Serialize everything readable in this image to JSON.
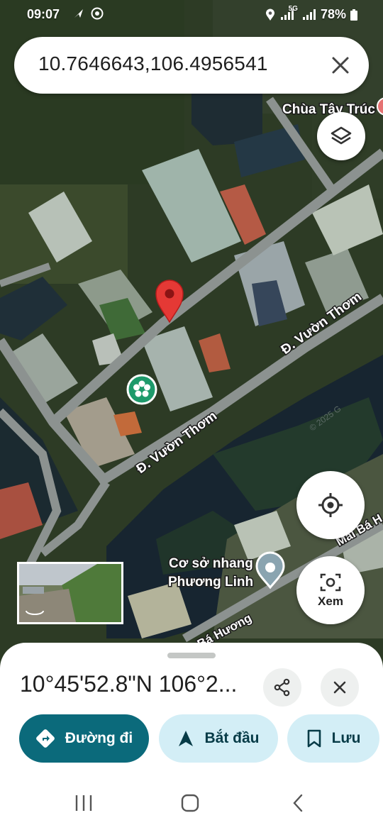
{
  "status_bar": {
    "time": "09:07",
    "battery": "78%",
    "network": "5G",
    "icons": [
      "navigation-arrow-icon",
      "chrome-icon",
      "location-icon",
      "signal-icon",
      "battery-icon"
    ]
  },
  "search": {
    "query": "10.7646643,106.4956541",
    "clear_icon": "close-icon"
  },
  "map": {
    "labels": {
      "poi_temple": "Chùa Tây Trúc",
      "street_vuon_thom_1": "Đ. Vườn Thơm",
      "street_vuon_thom_2": "Đ. Vườn Thơm",
      "poi_incense": "Cơ sở nhang\nPhương Linh",
      "poi_incense_line1": "Cơ sở nhang",
      "poi_incense_line2": "Phương Linh",
      "street_mai_ba": "Mai Bá H",
      "street_ba_huong": "Bá Hương",
      "watermark": "© 2025 G"
    },
    "dropped_pin_color": "#e53935",
    "accent_teal": "#0b6a7b"
  },
  "controls": {
    "layers_icon": "layers-icon",
    "locate_icon": "my-location-icon",
    "view_label": "Xem",
    "view_icon": "camera-scan-icon"
  },
  "sheet": {
    "title": "10°45'52.8\"N 106°2...",
    "share_icon": "share-icon",
    "close_icon": "close-icon",
    "actions": {
      "directions": "Đường đi",
      "start": "Bắt đầu",
      "save": "Lưu"
    }
  },
  "navbar": {
    "recents_icon": "recents-icon",
    "home_icon": "home-icon",
    "back_icon": "back-icon"
  }
}
